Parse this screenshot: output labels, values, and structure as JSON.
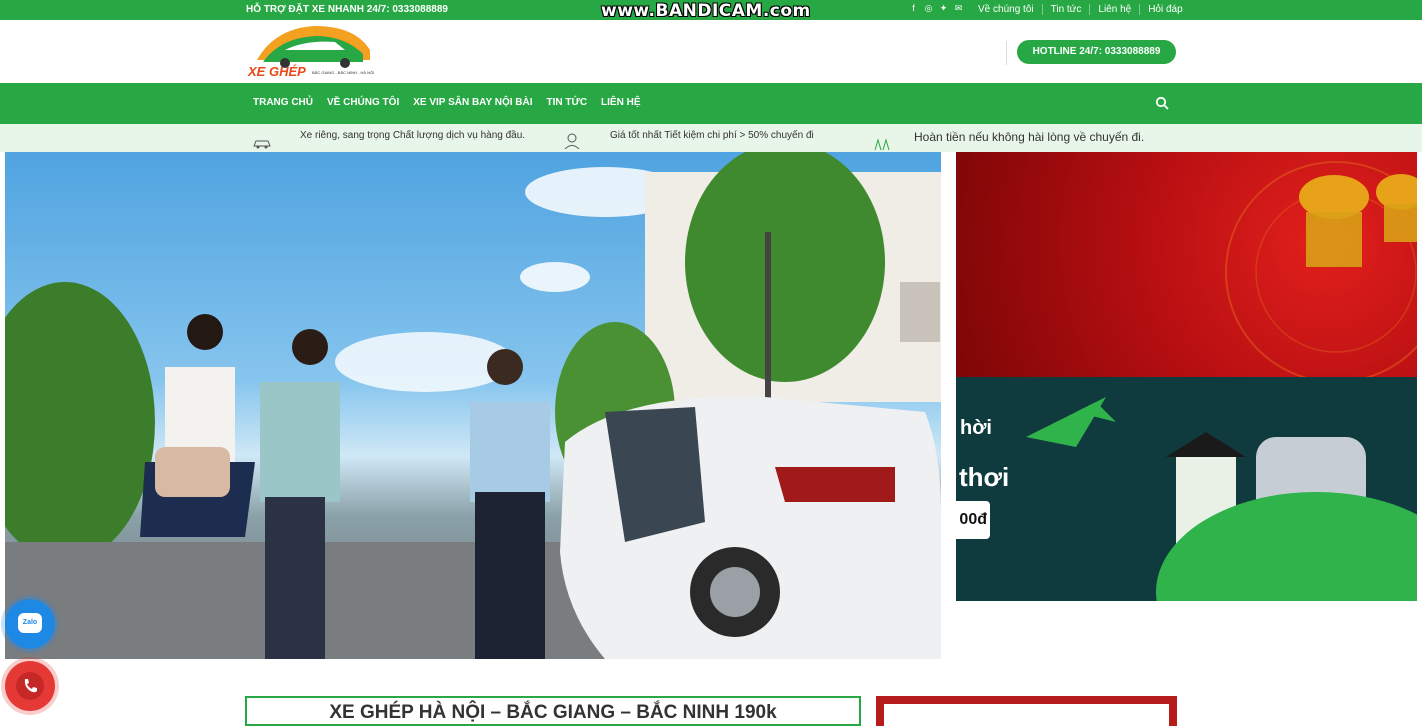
{
  "topbar": {
    "support": "HỖ TRỢ ĐẶT XE NHANH 24/7: 0333088889",
    "watermark": "www.BANDICAM.com",
    "links": [
      "Về chúng tôi",
      "Tin tức",
      "Liên hệ",
      "Hỏi đáp"
    ],
    "social_icons": [
      "facebook-icon",
      "instagram-icon",
      "twitter-icon",
      "email-icon"
    ]
  },
  "header": {
    "logo_text": "XE GHÉP",
    "logo_sub": "BẮC GIANG - BẮC NINH - HÀ NỘI",
    "hotline": "HOTLINE 24/7: 0333088889"
  },
  "nav": {
    "items": [
      "TRANG CHỦ",
      "VỀ CHÚNG TÔI",
      "XE VIP SÂN BAY NỘI BÀI",
      "TIN TỨC",
      "LIÊN HỆ"
    ]
  },
  "features": [
    {
      "icon": "car-icon",
      "text": "Xe riêng, sang trọng Chất lượng dịch vụ hàng đầu."
    },
    {
      "icon": "savings-icon",
      "text": "Giá tốt nhất Tiết kiệm chi phí > 50% chuyến đi"
    },
    {
      "icon": "refund-icon",
      "text": "Hoàn tiền nếu không hài lòng về chuyến đi."
    }
  ],
  "side_banner": {
    "word1": "hời",
    "word2": "thơi",
    "price_fragment": "00đ"
  },
  "contact": {
    "zalo_label": "Zalo"
  },
  "main": {
    "title": "XE GHÉP HÀ NỘI – BẮC GIANG – BẮC NINH 190k"
  },
  "colors": {
    "brand_green": "#27a844",
    "accent_red": "#b71c1c"
  }
}
